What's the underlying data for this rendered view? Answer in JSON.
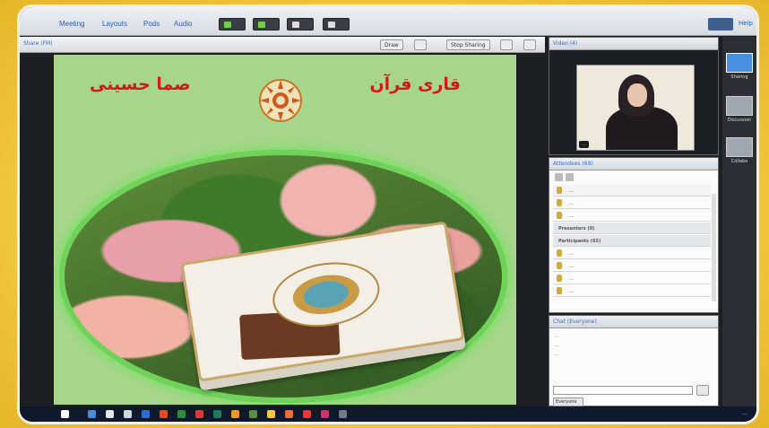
{
  "menu": {
    "items": [
      "Meeting",
      "Layouts",
      "Pods",
      "Audio"
    ],
    "help": "Help"
  },
  "share_pod": {
    "title": "Share (FM)",
    "buttons": [
      "Draw",
      "Stop Sharing"
    ]
  },
  "slide": {
    "name": "صما حسینی",
    "role": "قاری قرآن"
  },
  "video_pod": {
    "title": "Video (4)"
  },
  "attendees_pod": {
    "title": "Attendees (69)",
    "rows": [
      {
        "type": "host",
        "text": "…"
      },
      {
        "type": "person",
        "text": "…"
      },
      {
        "type": "person",
        "text": "…"
      },
      {
        "type": "section",
        "text": "Presenters (0)"
      },
      {
        "type": "section",
        "text": "Participants (65)"
      },
      {
        "type": "person",
        "text": "…"
      },
      {
        "type": "person",
        "text": "…"
      },
      {
        "type": "person",
        "text": "…"
      },
      {
        "type": "person",
        "text": "…"
      }
    ]
  },
  "chat_pod": {
    "title": "Chat (Everyone)",
    "tab": "Everyone"
  },
  "layouts_panel": {
    "items": [
      "Sharing",
      "Discussion",
      "Collabo"
    ]
  },
  "colors": {
    "accent": "#3a6cc0",
    "slide_bg": "#a8d58c",
    "slide_text": "#d11a1a"
  }
}
